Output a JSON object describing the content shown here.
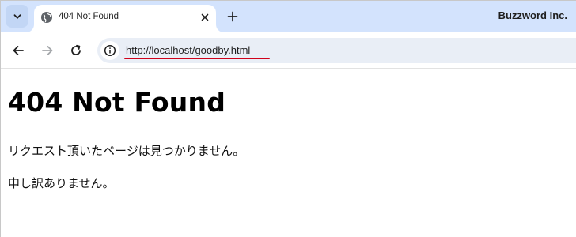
{
  "browser": {
    "tab": {
      "title": "404 Not Found"
    },
    "profile_name": "Buzzword Inc.",
    "omnibox": {
      "url": "http://localhost/goodby.html"
    },
    "icons": {
      "tab_search": "chevron-down-icon",
      "favicon": "globe-icon",
      "close": "close-icon",
      "new_tab": "plus-icon",
      "back": "arrow-left-icon",
      "forward": "arrow-right-icon",
      "reload": "reload-icon",
      "site_info": "info-icon"
    },
    "colors": {
      "tabstrip": "#d3e3fd",
      "omnibox": "#e9eef6",
      "url_underline": "#d0021b"
    }
  },
  "page": {
    "heading": "404 Not Found",
    "paragraphs": [
      "リクエスト頂いたページは見つかりません。",
      "申し訳ありません。"
    ]
  }
}
